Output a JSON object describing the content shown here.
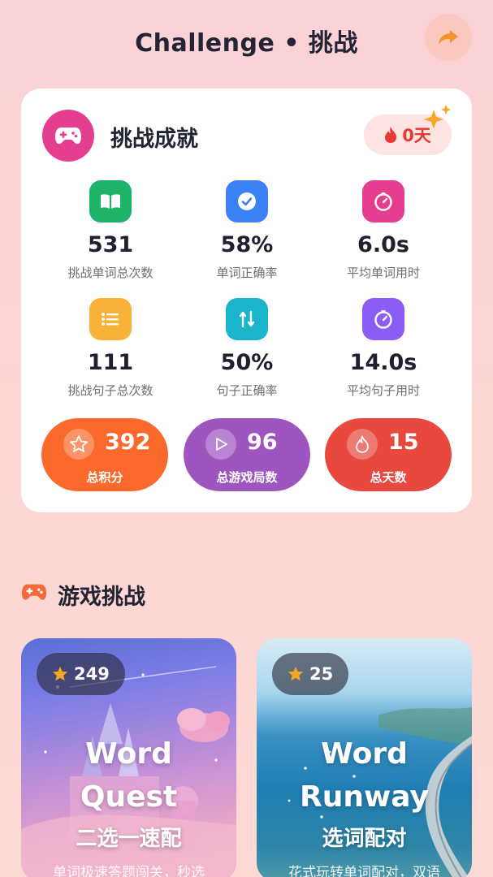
{
  "header": {
    "title": "Challenge • 挑战",
    "share_icon": "share-forward-icon"
  },
  "achievements": {
    "title": "挑战成就",
    "icon": "gamepad-icon",
    "streak": "0天",
    "stats": [
      {
        "value": "531",
        "label": "挑战单词总次数",
        "icon": "book-icon",
        "color": "#1db46a"
      },
      {
        "value": "58%",
        "label": "单词正确率",
        "icon": "check-circle-icon",
        "color": "#3b82f6"
      },
      {
        "value": "6.0s",
        "label": "平均单词用时",
        "icon": "timer-icon",
        "color": "#e53d8f"
      },
      {
        "value": "111",
        "label": "挑战句子总次数",
        "icon": "list-icon",
        "color": "#f8b23a"
      },
      {
        "value": "50%",
        "label": "句子正确率",
        "icon": "swap-icon",
        "color": "#1ab4cc"
      },
      {
        "value": "14.0s",
        "label": "平均句子用时",
        "icon": "timer-icon",
        "color": "#8b5cf6"
      }
    ],
    "totals": [
      {
        "value": "392",
        "label": "总积分",
        "icon": "star-outline-icon",
        "color": "#fb6a2c"
      },
      {
        "value": "96",
        "label": "总游戏局数",
        "icon": "play-icon",
        "color": "#9f55c0"
      },
      {
        "value": "15",
        "label": "总天数",
        "icon": "flame-icon",
        "color": "#e8483e"
      }
    ]
  },
  "games_section": {
    "title": "游戏挑战",
    "icon": "gamepad-icon"
  },
  "games": [
    {
      "stars": "249",
      "name_line1": "Word",
      "name_line2": "Quest",
      "subtitle": "二选一速配",
      "description": "单词极速答题闯关，秒选"
    },
    {
      "stars": "25",
      "name_line1": "Word",
      "name_line2": "Runway",
      "subtitle": "选词配对",
      "description": "花式玩转单词配对，双语"
    }
  ]
}
